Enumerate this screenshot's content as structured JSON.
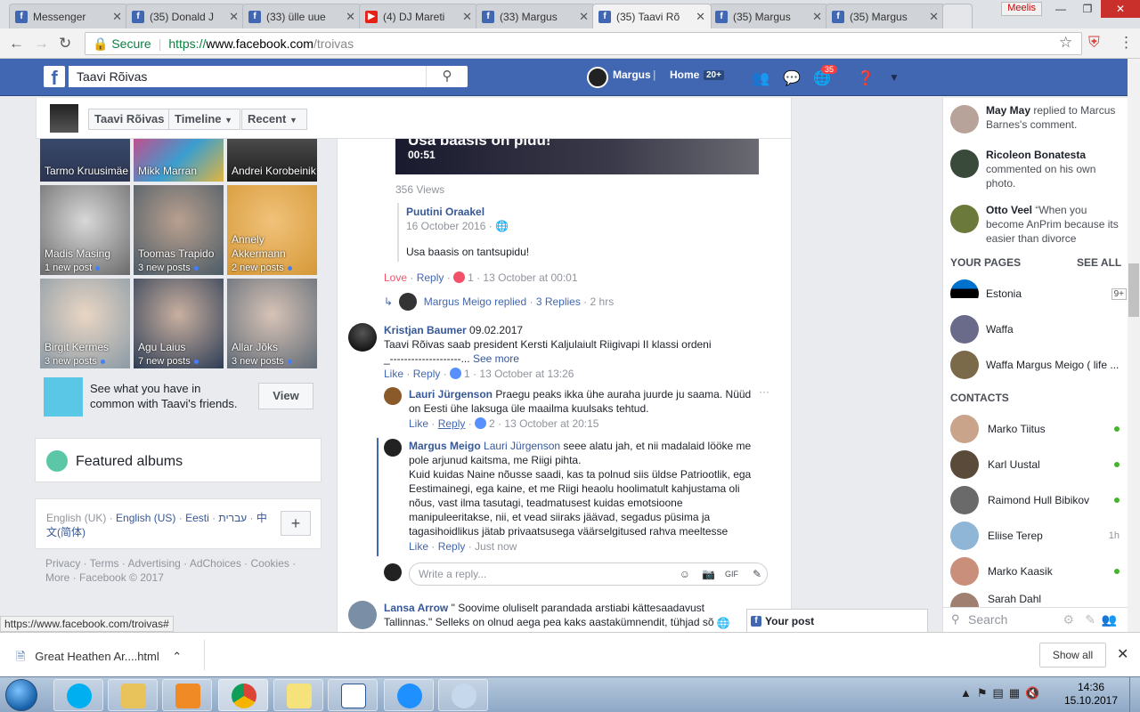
{
  "browser": {
    "tabs": [
      {
        "title": "Messenger",
        "icon": "facebook-icon"
      },
      {
        "title": "(35) Donald J",
        "icon": "facebook-icon"
      },
      {
        "title": "(33) ülle uue",
        "icon": "facebook-icon"
      },
      {
        "title": "(4) DJ Mareti",
        "icon": "youtube-icon"
      },
      {
        "title": "(33) Margus",
        "icon": "facebook-icon"
      },
      {
        "title": "(35) Taavi Rõ",
        "icon": "facebook-icon",
        "active": true
      },
      {
        "title": "(35) Margus",
        "icon": "facebook-icon"
      },
      {
        "title": "(35) Margus",
        "icon": "facebook-icon"
      }
    ],
    "user_label": "Meelis",
    "secure_label": "Secure",
    "url_proto": "https://",
    "url_host": "www.facebook.com",
    "url_path": "/troivas",
    "status_url": "https://www.facebook.com/troivas#"
  },
  "fb_header": {
    "search_value": "Taavi Rõivas",
    "user_name": "Margus",
    "home_label": "Home",
    "home_badge": "20+",
    "notif_badge": "35"
  },
  "profile_nav": {
    "name": "Taavi Rõivas",
    "timeline_label": "Timeline",
    "recent_label": "Recent"
  },
  "friends": [
    {
      "name": "Tarmo Kruusimäe",
      "posts": ""
    },
    {
      "name": "Mikk Marran",
      "posts": ""
    },
    {
      "name": "Andrei Korobeinik",
      "posts": ""
    },
    {
      "name": "Madis Masing",
      "posts": "1 new post"
    },
    {
      "name": "Toomas Trapido",
      "posts": "3 new posts"
    },
    {
      "name": "Annely Akkermann",
      "posts": "2 new posts"
    },
    {
      "name": "Birgit Kermes",
      "posts": "3 new posts"
    },
    {
      "name": "Agu Laius",
      "posts": "7 new posts"
    },
    {
      "name": "Allar Jõks",
      "posts": "3 new posts"
    }
  ],
  "common": {
    "text": "See what you have in common with Taavi's friends.",
    "button": "View"
  },
  "featured_albums": "Featured albums",
  "languages": {
    "current": "English (UK)",
    "others": [
      "English (US)",
      "Eesti",
      "עברית",
      "中文(简体)"
    ]
  },
  "footer_links": "Privacy · Terms · Advertising · AdChoices · Cookies · More · Facebook © 2017",
  "video": {
    "title": "Usa baasis on pidu!",
    "duration": "00:51",
    "views": "356 Views"
  },
  "shared": {
    "author": "Puutini Oraakel",
    "date": "16 October 2016 ·",
    "text": "Usa baasis on tantsupidu!"
  },
  "post_actions": {
    "love": "Love",
    "reply": "Reply",
    "count": "1",
    "time": "13 October at 00:01",
    "replied": "Margus Meigo replied",
    "replies": "3 Replies",
    "replies_time": "2 hrs"
  },
  "comments": [
    {
      "author": "Kristjan Baumer",
      "date": "09.02.2017",
      "text1": "Taavi Rõivas saab president Kersti Kaljulaiult Riigivapi II klassi ordeni",
      "text2": "_--------------------...",
      "see_more": "See more",
      "like": "Like",
      "reply": "Reply",
      "count": "1",
      "time": "13 October at 13:26"
    },
    {
      "author": "Lauri Jürgenson",
      "text": "Praegu peaks ikka ühe auraha juurde ju saama. Nüüd on Eesti ühe laksuga üle maailma kuulsaks tehtud.",
      "like": "Like",
      "reply": "Reply",
      "count": "2",
      "time": "13 October at 20:15"
    },
    {
      "author": "Margus Meigo",
      "mention": "Lauri Jürgenson",
      "text1": "seee alatu jah, et nii madalaid lööke me pole arjunud kaitsma, me Riigi pihta.",
      "text2": "Kuid kuidas Naine nõusse saadi, kas ta polnud siis üldse Patriootlik, ega Eestimainegi, ega kaine, et me Riigi heaolu hoolimatult kahjustama oli nõus, vast ilma tasutagi, teadmatusest kuidas emotsioone manipuleeritakse, nii, et vead siiraks jäävad, segadus püsima ja tagasihoidlikus jätab privaatsusega väärselgitused rahva meeltesse",
      "like": "Like",
      "reply": "Reply",
      "time": "Just now"
    },
    {
      "author": "Lansa Arrow",
      "text": "\" Soovime oluliselt parandada arstiabi kättesaadavust Tallinnas.\" Selleks on olnud aega pea kaks aastakümnendit, tühjad sõnad tervist"
    }
  ],
  "reply_placeholder": "Write a reply...",
  "right_sidebar": {
    "notifications": [
      {
        "who": "May May",
        "text": "replied to Marcus Barnes's comment."
      },
      {
        "who": "Ricoleon Bonatesta",
        "text": "commented on his own photo."
      },
      {
        "who": "Otto Veel",
        "text": "“When you become AnPrim because its easier than divorce"
      }
    ],
    "your_pages_title": "YOUR PAGES",
    "see_all": "SEE ALL",
    "pages": [
      {
        "name": "Estonia",
        "badge": "9+"
      },
      {
        "name": "Waffa",
        "badge": ""
      },
      {
        "name": "Waffa Margus Meigo ( life ...",
        "badge": ""
      }
    ],
    "contacts_title": "CONTACTS",
    "contacts": [
      {
        "name": "Marko Tiitus",
        "status": "online"
      },
      {
        "name": "Karl Uustal",
        "status": "online"
      },
      {
        "name": "Raimond Hull Bibikov",
        "status": "online"
      },
      {
        "name": "Eliise Terep",
        "status": "1h"
      },
      {
        "name": "Marko Kaasik",
        "status": "online"
      },
      {
        "name": "Sarah Dahl",
        "status": ""
      }
    ],
    "search_placeholder": "Search"
  },
  "your_post": "Your post",
  "downloads": {
    "file": "Great Heathen Ar....html",
    "show_all": "Show all"
  },
  "taskbar": {
    "time": "14:36",
    "date": "15.10.2017"
  },
  "colors": {
    "fb_blue": "#4267b2",
    "link": "#365899",
    "online": "#42b72a"
  }
}
